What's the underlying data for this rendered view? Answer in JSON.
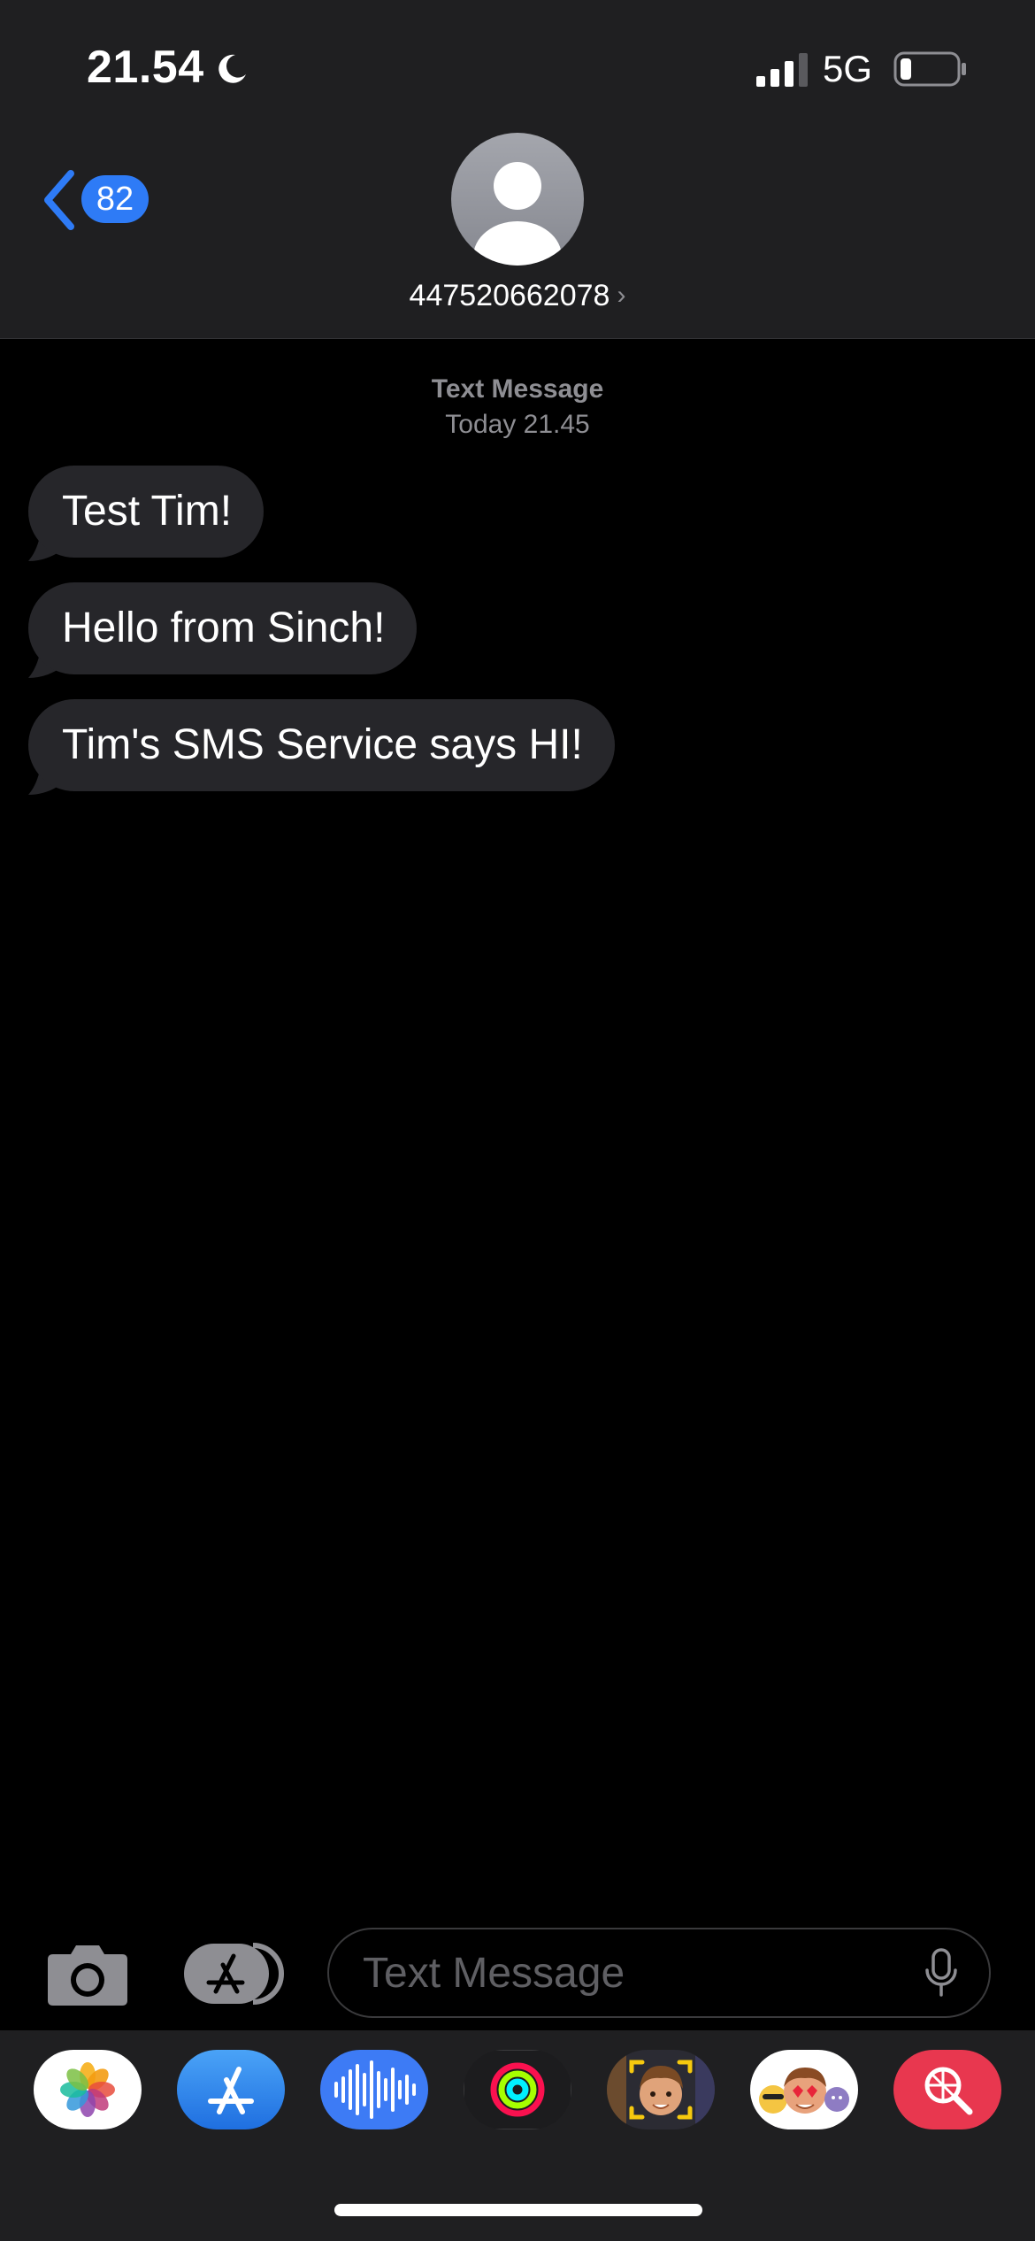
{
  "status_bar": {
    "time": "21.54",
    "network": "5G"
  },
  "header": {
    "back_badge": "82",
    "contact": "447520662078"
  },
  "conversation": {
    "service_label": "Text Message",
    "timestamp": "Today 21.45",
    "messages": [
      {
        "text": "Test Tim!"
      },
      {
        "text": "Hello from Sinch!"
      },
      {
        "text": "Tim's SMS Service says HI!"
      }
    ]
  },
  "input": {
    "placeholder": "Text Message"
  },
  "app_tray": [
    {
      "icon": "photos-icon"
    },
    {
      "icon": "app-store-icon"
    },
    {
      "icon": "audio-message-icon"
    },
    {
      "icon": "activity-icon"
    },
    {
      "icon": "memoji-icon"
    },
    {
      "icon": "memoji-stickers-icon"
    },
    {
      "icon": "images-search-icon"
    }
  ],
  "colors": {
    "accent": "#2e7bf6",
    "bubble": "#26262a",
    "header_bg": "#1f1f21",
    "background": "#000000"
  }
}
